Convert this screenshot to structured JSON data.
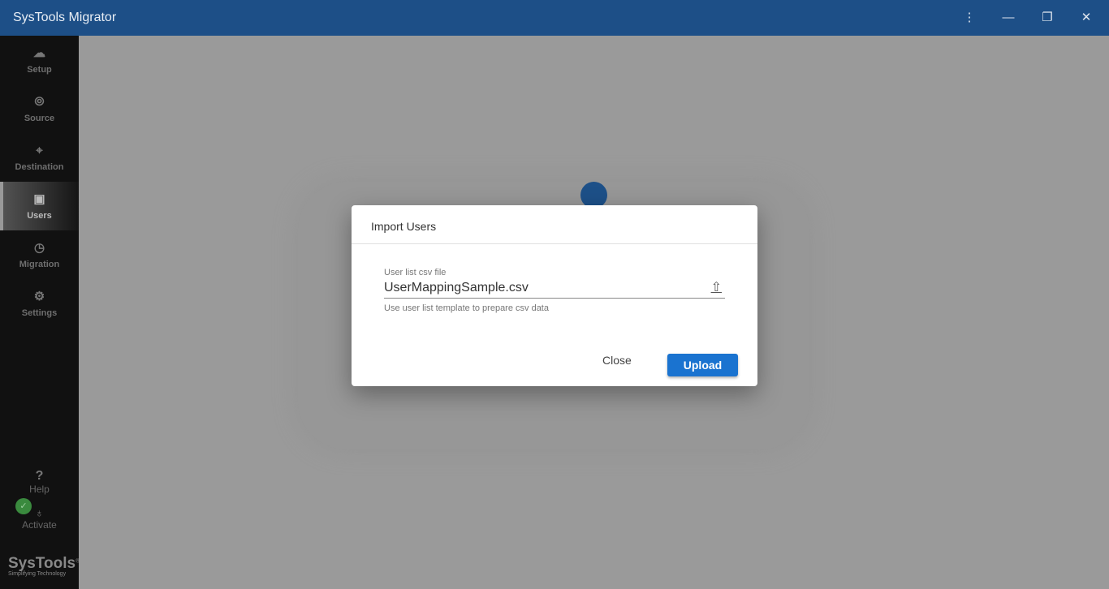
{
  "app": {
    "title": "SysTools Migrator",
    "accent": "#1d4f87"
  },
  "window": {
    "menu_icon": "⋮",
    "minimize_icon": "—",
    "restore_icon": "❐",
    "close_icon": "✕"
  },
  "sidebar": {
    "items": [
      {
        "label": "Setup",
        "icon": "☁"
      },
      {
        "label": "Source",
        "icon": "⦾"
      },
      {
        "label": "Destination",
        "icon": "⌖"
      },
      {
        "label": "Users",
        "icon": "▣",
        "active": true
      },
      {
        "label": "Migration",
        "icon": "◷"
      },
      {
        "label": "Settings",
        "icon": "⚙"
      }
    ],
    "help": {
      "icon": "?",
      "label": "Help"
    },
    "activate": {
      "icon": "♁",
      "label": "Activate",
      "status_icon": "✓"
    },
    "logo": {
      "name": "SysTools",
      "tagline": "Simplifying Technology",
      "mark": "®"
    }
  },
  "dialog": {
    "title": "Import Users",
    "field_label": "User list csv file",
    "field_value": "UserMappingSample.csv",
    "upload_icon": "⇧",
    "hint": "Use user list template to prepare csv data",
    "close_label": "Close",
    "upload_label": "Upload"
  }
}
